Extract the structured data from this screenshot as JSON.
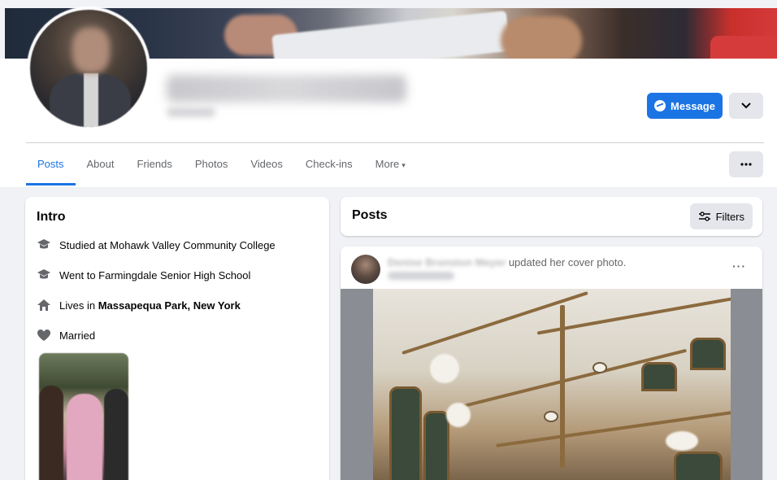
{
  "colors": {
    "accent": "#1b74e4",
    "page_bg": "#f0f2f5",
    "card_bg": "#ffffff",
    "secondary_text": "#65676b"
  },
  "profile": {
    "message_button": "Message",
    "dropdown_icon": "chevron-down-icon",
    "more_icon": "ellipsis-icon"
  },
  "tabs": [
    {
      "label": "Posts",
      "active": true
    },
    {
      "label": "About"
    },
    {
      "label": "Friends"
    },
    {
      "label": "Photos"
    },
    {
      "label": "Videos"
    },
    {
      "label": "Check-ins"
    },
    {
      "label": "More",
      "caret": "▾"
    }
  ],
  "intro": {
    "title": "Intro",
    "items": [
      {
        "icon": "graduation-cap-icon",
        "text": "Studied at Mohawk Valley Community College"
      },
      {
        "icon": "graduation-cap-icon",
        "text": "Went to Farmingdale Senior High School"
      },
      {
        "icon": "home-icon",
        "prefix": "Lives in ",
        "bold": "Massapequa Park, New York"
      },
      {
        "icon": "heart-icon",
        "text": "Married"
      }
    ]
  },
  "posts": {
    "title": "Posts",
    "filters_label": "Filters",
    "post": {
      "author": "Denise Bronston Meyer",
      "action": " updated her cover photo.",
      "more": "···"
    }
  }
}
